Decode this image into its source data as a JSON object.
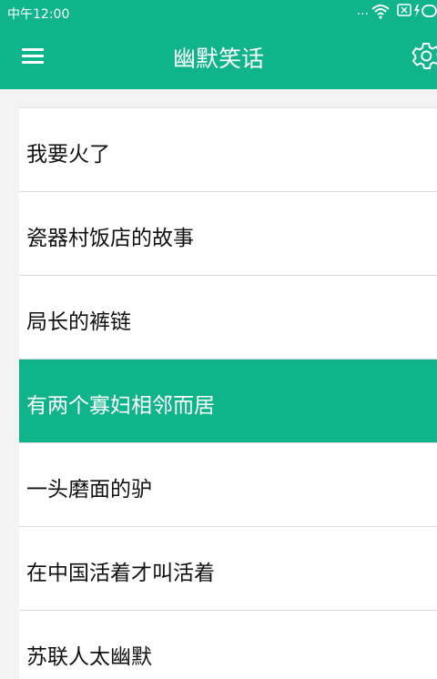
{
  "status_bar": {
    "time": "中午12:00",
    "dots": "...",
    "wifi_icon": "wifi-icon",
    "sim_icon": "sim-off-icon",
    "battery_icon": "battery-charging-icon"
  },
  "header": {
    "title": "幽默笑话",
    "menu_icon": "hamburger-menu-icon",
    "settings_icon": "gear-icon"
  },
  "colors": {
    "accent": "#0fb48a",
    "background": "#f3f3f3",
    "text": "#111111"
  },
  "list": {
    "selected_index": 3,
    "items": [
      {
        "label": "我要火了"
      },
      {
        "label": "瓷器村饭店的故事"
      },
      {
        "label": "局长的裤链"
      },
      {
        "label": "有两个寡妇相邻而居"
      },
      {
        "label": "一头磨面的驴"
      },
      {
        "label": "在中国活着才叫活着"
      },
      {
        "label": "苏联人太幽默"
      }
    ]
  }
}
